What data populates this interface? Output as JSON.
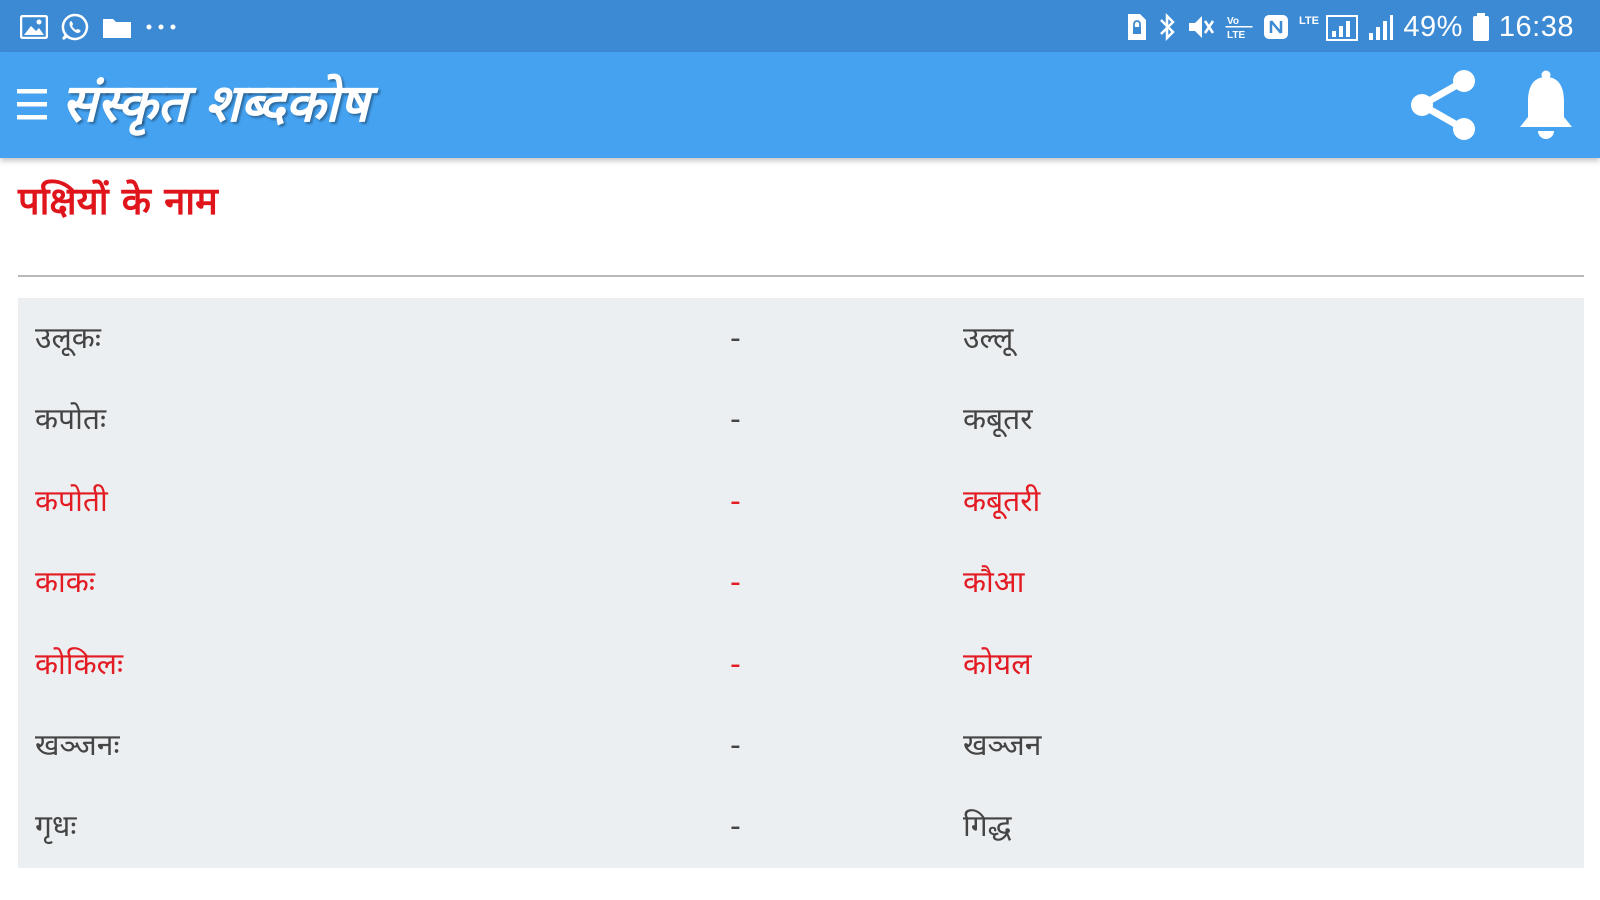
{
  "status_bar": {
    "left_icons": [
      "gallery-icon",
      "whatsapp-icon",
      "folder-icon",
      "more-dots-icon"
    ],
    "right_icons": [
      "sim-lock-icon",
      "bluetooth-icon",
      "mute-icon",
      "volte-icon",
      "nfc-icon",
      "lte-signal-icon",
      "signal-bars-icon",
      "battery-icon"
    ],
    "battery": "49%",
    "time": "16:38"
  },
  "app_bar": {
    "title": "संस्कृत शब्दकोष",
    "menu_icon": "menu-icon",
    "share_icon": "share-icon",
    "bell_icon": "bell-icon"
  },
  "section": {
    "title": "पक्षियों के नाम"
  },
  "colors": {
    "status_bar": "#3d8ad4",
    "app_bar": "#45a2f1",
    "accent_red": "#e31b23",
    "table_bg": "#eceff1"
  },
  "words": [
    {
      "sanskrit": "उलूकः",
      "sep": "-",
      "hindi": "उल्लू",
      "highlight": false
    },
    {
      "sanskrit": "कपोतः",
      "sep": "-",
      "hindi": "कबूतर",
      "highlight": false
    },
    {
      "sanskrit": "कपोती",
      "sep": "-",
      "hindi": "कबूतरी",
      "highlight": true
    },
    {
      "sanskrit": "काकः",
      "sep": "-",
      "hindi": "कौआ",
      "highlight": true
    },
    {
      "sanskrit": "कोकिलः",
      "sep": "-",
      "hindi": "कोयल",
      "highlight": true
    },
    {
      "sanskrit": "खञ्जनः",
      "sep": "-",
      "hindi": "खञ्जन",
      "highlight": false
    },
    {
      "sanskrit": "गृधः",
      "sep": "-",
      "hindi": "गिद्ध",
      "highlight": false
    }
  ]
}
